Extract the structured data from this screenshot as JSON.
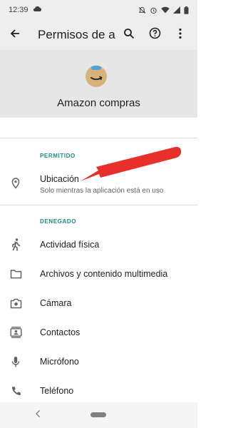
{
  "status_bar": {
    "time": "12:39",
    "icons": [
      "cloud-sync-icon",
      "mute-icon",
      "alarm-icon",
      "wifi-icon",
      "signal-icon",
      "battery-icon"
    ]
  },
  "app_bar": {
    "title": "Permisos de a…",
    "icons": [
      "back-arrow-icon",
      "search-icon",
      "help-icon",
      "more-vert-icon"
    ]
  },
  "header": {
    "app_name": "Amazon compras"
  },
  "sections": {
    "allowed_label": "PERMITIDO",
    "denied_label": "DENEGADO"
  },
  "allowed": [
    {
      "title": "Ubicación",
      "subtitle": "Solo mientras la aplicación está en uso",
      "icon": "location-icon"
    }
  ],
  "denied": [
    {
      "title": "Actividad física",
      "icon": "walking-icon"
    },
    {
      "title": "Archivos y contenido multimedia",
      "icon": "folder-icon"
    },
    {
      "title": "Cámara",
      "icon": "camera-icon"
    },
    {
      "title": "Contactos",
      "icon": "contacts-icon"
    },
    {
      "title": "Micrófono",
      "icon": "microphone-icon"
    },
    {
      "title": "Teléfono",
      "icon": "phone-icon"
    }
  ],
  "colors": {
    "accent": "#1a8a85",
    "annotation_arrow": "#e8302a",
    "header_bg": "#e6e6e6"
  }
}
